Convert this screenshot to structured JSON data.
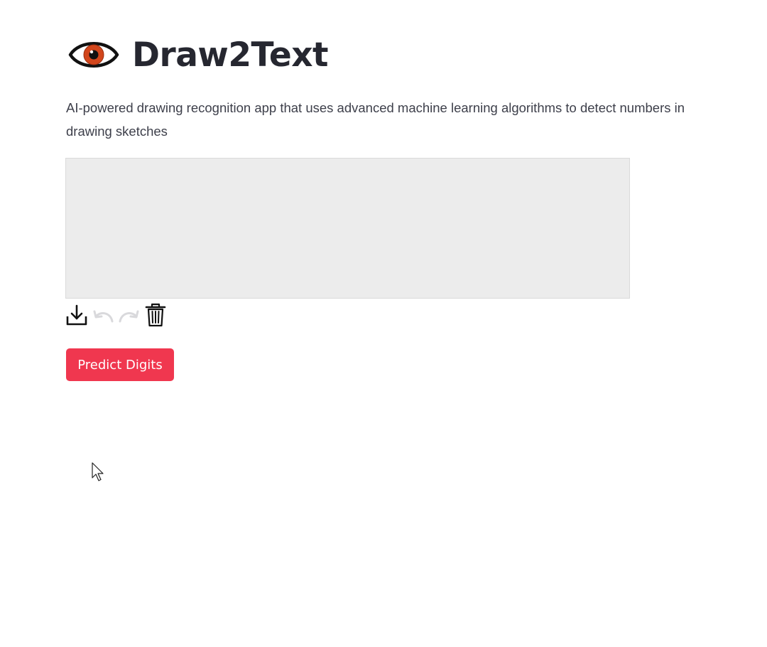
{
  "header": {
    "title": "Draw2Text",
    "icon": "eye-icon"
  },
  "description": "AI-powered drawing recognition app that uses advanced machine learning algorithms to detect numbers in drawing sketches",
  "canvas": {
    "background": "#ececec"
  },
  "toolbar": {
    "tools": [
      {
        "icon": "download-icon",
        "enabled": true
      },
      {
        "icon": "undo-icon",
        "enabled": false
      },
      {
        "icon": "redo-icon",
        "enabled": false
      },
      {
        "icon": "trash-icon",
        "enabled": true
      }
    ]
  },
  "actions": {
    "predict_label": "Predict Digits",
    "predict_color": "#f0374f"
  }
}
